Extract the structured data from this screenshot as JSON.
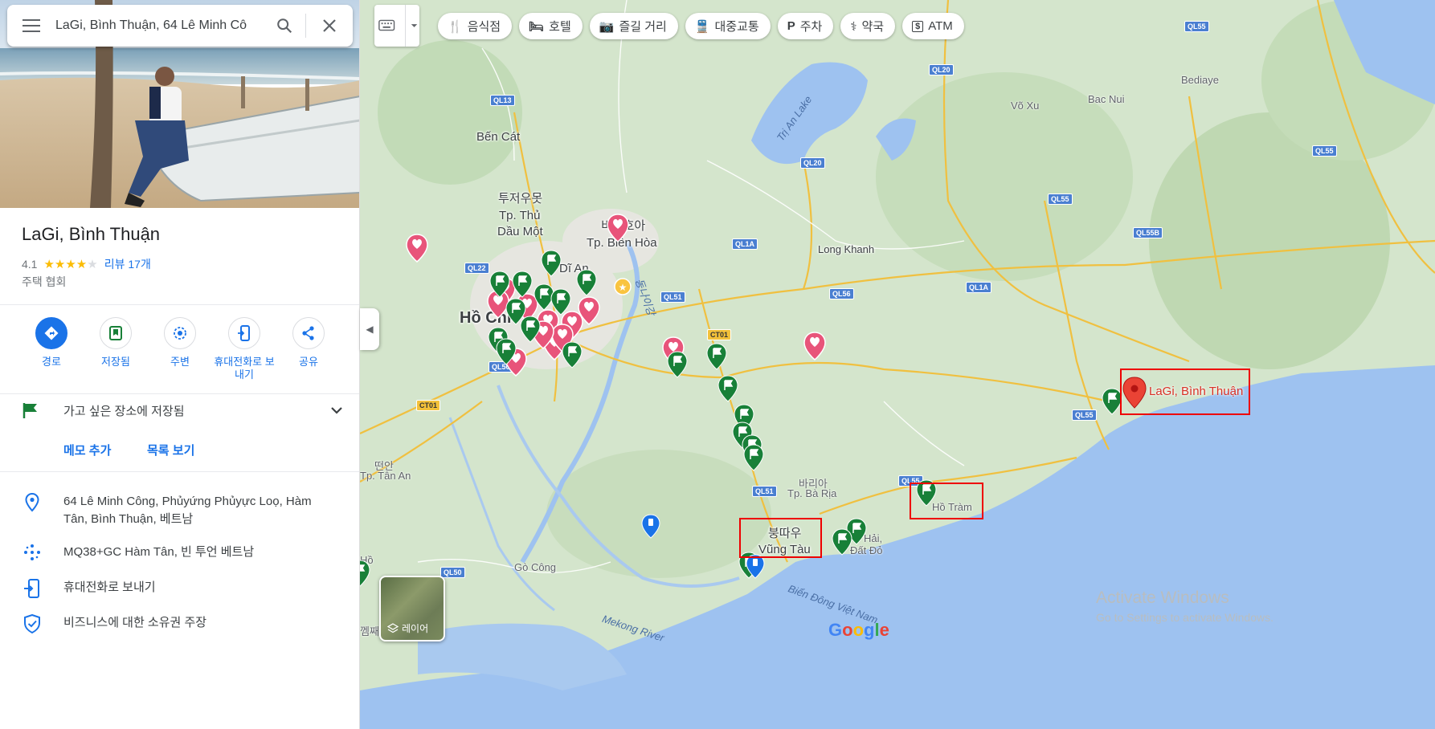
{
  "search": {
    "query": "LaGi, Bình Thuận, 64 Lê Minh Cô"
  },
  "place": {
    "name": "LaGi, Bình Thuận",
    "rating": "4.1",
    "stars": 4,
    "reviews": "리뷰 17개",
    "category": "주택 협회"
  },
  "actions": [
    {
      "label": "경로",
      "icon": "directions-icon"
    },
    {
      "label": "저장됨",
      "icon": "bookmark-icon"
    },
    {
      "label": "주변",
      "icon": "nearby-icon"
    },
    {
      "label": "휴대전화로 보내기",
      "icon": "phone-send-icon"
    },
    {
      "label": "공유",
      "icon": "share-icon"
    }
  ],
  "saved": {
    "text": "가고 싶은 장소에 저장됨",
    "memo": "메모 추가",
    "list": "목록 보기"
  },
  "info": {
    "address": "64 Lê Minh Công, Phủyứng Phủyực Loọ, Hàm Tân, Bình Thuận, 베트남",
    "plus_code": "MQ38+GC Hàm Tân, 빈 투언 베트남",
    "send_phone": "휴대전화로 보내기",
    "claim": "비즈니스에 대한 소유권 주장"
  },
  "chips": [
    {
      "label": "음식점",
      "icon": "restaurant-icon",
      "glyph": "🍴"
    },
    {
      "label": "호텔",
      "icon": "hotel-icon",
      "glyph": "🛏"
    },
    {
      "label": "즐길 거리",
      "icon": "camera-icon",
      "glyph": "📷"
    },
    {
      "label": "대중교통",
      "icon": "transit-icon",
      "glyph": "🚆"
    },
    {
      "label": "주차",
      "icon": "parking-icon",
      "glyph": "P"
    },
    {
      "label": "약국",
      "icon": "pharmacy-icon",
      "glyph": "⚕"
    },
    {
      "label": "ATM",
      "icon": "atm-icon",
      "glyph": "$"
    }
  ],
  "map": {
    "layer_label": "레이어",
    "selected_label": "LaGi, Bình Thuận",
    "google": "Google",
    "watermark_title": "Activate Windows",
    "watermark_sub": "Go to Settings to activate Windows.",
    "labels": {
      "bencat": "Bến Cát",
      "tdm_ko": "투저우못",
      "tdm": "Tp. Thủ",
      "tdm2": "Dầu Một",
      "dian": "Dĩ An",
      "bh_ko": "비엔호아",
      "bh": "Tp. Biên Hòa",
      "hcm": "Hồ Chí",
      "longkhanh": "Long Khanh",
      "voxu": "Võ Xu",
      "bacnui": "Bac Nui",
      "bediaye": "Bediaye",
      "trian": "Trị An Lake",
      "tanan_ko": "떤안",
      "tanan": "Tp. Tân An",
      "baria_ko": "바리아",
      "baria": "Tp. Bà Rịa",
      "vt_ko": "붕따우",
      "vt": "Vũng Tàu",
      "hotram": "Hồ Tràm",
      "haidat1": "Hải,",
      "haidat2": "Đất Đỏ",
      "gocong": "Gò Công",
      "biendong": "Biển Đông Việt Nam",
      "mekong": "Mekong River",
      "river": "동나이강",
      "hoshort": "Hồ",
      "kem": "껨째"
    },
    "roads": [
      "QL13",
      "QL20",
      "QL20",
      "QL55",
      "QL55",
      "QL55",
      "QL55B",
      "QL1A",
      "QL1A",
      "QL22",
      "QL51",
      "QL56",
      "CT01",
      "CT01",
      "QL50",
      "QL50",
      "QL51",
      "QL55",
      "QL55"
    ]
  }
}
